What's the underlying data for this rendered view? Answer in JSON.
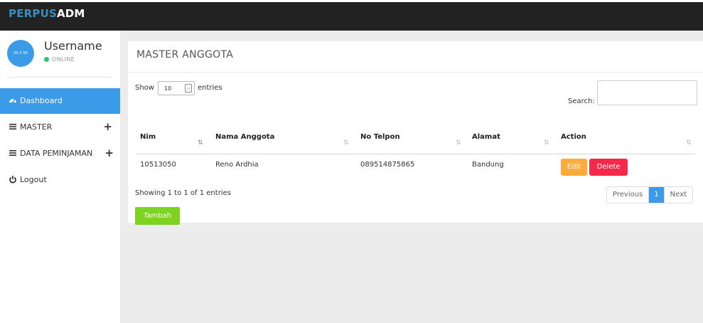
{
  "brand": {
    "part1": "PERPUS",
    "part2": "ADM"
  },
  "user": {
    "avatar_text": "50 X 50",
    "name": "Username",
    "status": "ONLINE"
  },
  "nav": [
    {
      "label": "Dashboard",
      "icon": "dashboard-icon"
    },
    {
      "label": "MASTER",
      "icon": "menu-lines-icon",
      "expand": "+"
    },
    {
      "label": "DATA PEMINJAMAN",
      "icon": "menu-lines-icon",
      "expand": "+"
    },
    {
      "label": "Logout",
      "icon": "power-icon"
    }
  ],
  "box": {
    "title": "MASTER ANGGOTA"
  },
  "table_controls": {
    "show_label": "Show",
    "page_size": "10",
    "entries_label": "entries",
    "search_label": "Search:"
  },
  "table": {
    "columns": [
      "Nim",
      "Nama Anggota",
      "No Telpon",
      "Alamat",
      "Action"
    ],
    "rows": [
      {
        "nim": "10513050",
        "nama": "Reno Ardhia",
        "telpon": "089514875865",
        "alamat": "Bandung"
      }
    ],
    "edit_label": "Edit",
    "delete_label": "Delete"
  },
  "info": "Showing 1 to 1 of 1 entries",
  "pagination": {
    "previous": "Previous",
    "current": "1",
    "next": "Next"
  },
  "add_button": "Tambah",
  "colors": {
    "topbar": "#222222",
    "accent": "#3c9be8",
    "brand_accent": "#3c8dbc",
    "edit": "#fdab3d",
    "delete": "#f7284a",
    "add": "#7ed321",
    "online": "#28c76f"
  }
}
